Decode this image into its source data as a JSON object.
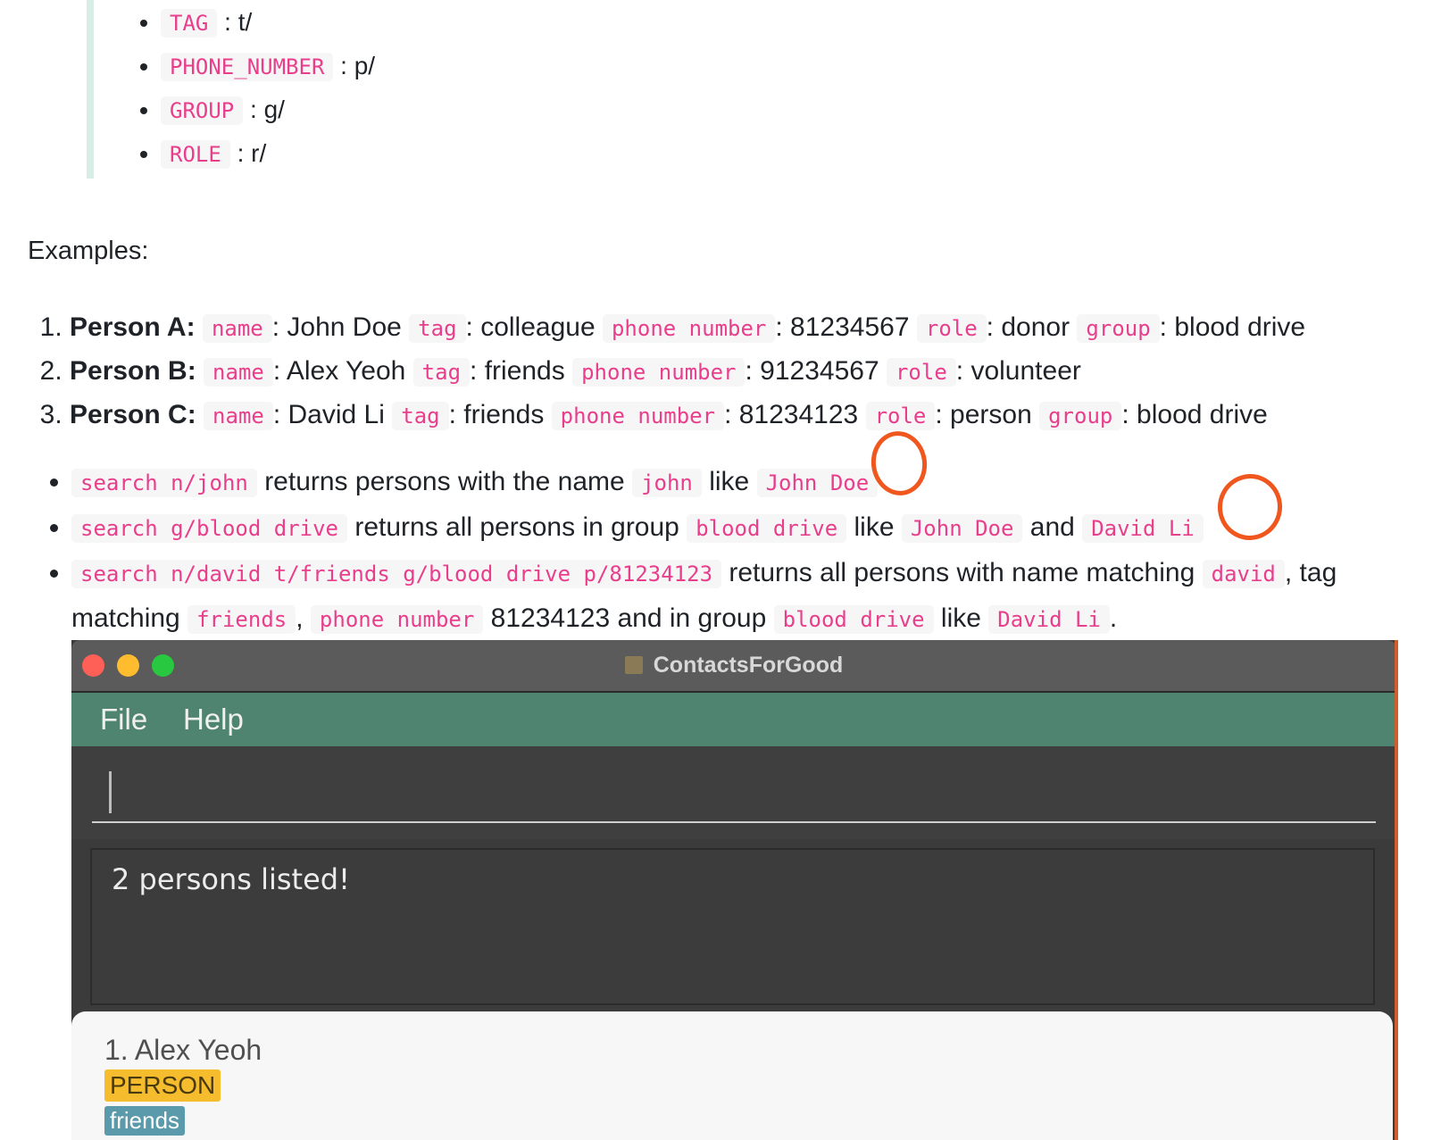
{
  "prefix_list": [
    {
      "code": "TAG",
      "text": ": t/"
    },
    {
      "code": "PHONE_NUMBER",
      "text": ": p/"
    },
    {
      "code": "GROUP",
      "text": ": g/"
    },
    {
      "code": "ROLE",
      "text": ": r/"
    }
  ],
  "examples_label": "Examples:",
  "persons": [
    {
      "label": "Person A:",
      "name_key": "name",
      "name": ": John Doe",
      "tag_key": "tag",
      "tag": ": colleague",
      "phone_key": "phone number",
      "phone": ": 81234567",
      "role_key": "role",
      "role": ": donor",
      "group_key": "group",
      "group": ": blood drive"
    },
    {
      "label": "Person B:",
      "name_key": "name",
      "name": ": Alex Yeoh",
      "tag_key": "tag",
      "tag": ": friends",
      "phone_key": "phone number",
      "phone": ": 91234567",
      "role_key": "role",
      "role": ": volunteer"
    },
    {
      "label": "Person C:",
      "name_key": "name",
      "name": ": David Li",
      "tag_key": "tag",
      "tag": ": friends",
      "phone_key": "phone number",
      "phone": ": 81234123",
      "role_key": "role",
      "role": ": person",
      "group_key": "group",
      "group": ": blood drive"
    }
  ],
  "search_examples": [
    {
      "cmd": "search n/john",
      "t1": "returns persons with the name",
      "c1": "john",
      "t2": "like",
      "c2": "John Doe"
    },
    {
      "cmd": "search g/blood drive",
      "t1": "returns all persons in group",
      "c1": "blood drive",
      "t2": "like",
      "c2": "John Doe",
      "t3": "and",
      "c3": "David Li"
    },
    {
      "cmd": "search n/david t/friends g/blood drive p/81234123",
      "t1": "returns all persons with name matching",
      "c1": "david",
      "t2": ", tag matching",
      "c2": "friends",
      "t3": ",",
      "c3": "phone number",
      "t4": "81234123 and in group",
      "c4": "blood drive",
      "t5": "like",
      "c5": "David Li",
      "t6": "."
    }
  ],
  "app": {
    "title": "ContactsForGood",
    "menu": [
      "File",
      "Help"
    ],
    "command_value": "",
    "result": "2 persons listed!",
    "first_card": {
      "name": "1. Alex Yeoh",
      "role": "PERSON",
      "tag": "friends"
    },
    "colors": {
      "titlebar": "#5b5b5b",
      "menubar": "#4e8470",
      "close": "#fe5f57",
      "minimize": "#febc2e",
      "zoom": "#28c840",
      "role_badge": "#f5bd2d",
      "tag_badge": "#5a9aaa",
      "annotation_circle": "#f0571f"
    }
  }
}
